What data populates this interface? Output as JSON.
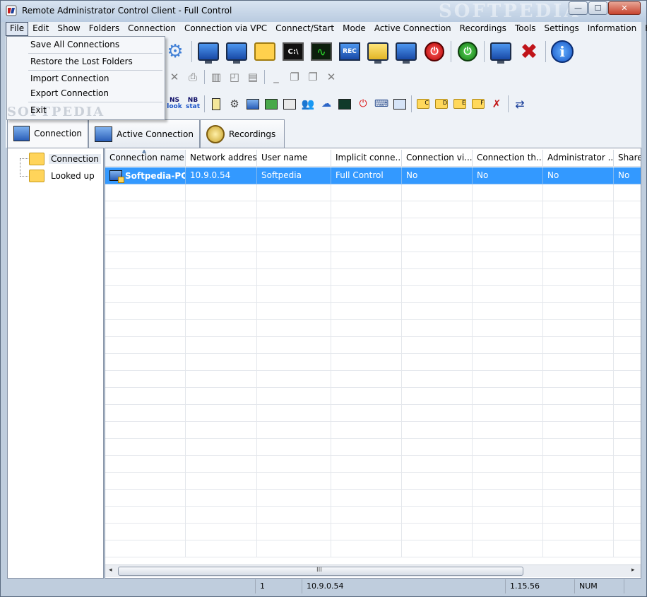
{
  "window": {
    "title": "Remote Administrator Control Client - Full Control",
    "watermark": "SOFTPEDIA",
    "controls": {
      "minimize": "—",
      "maximize": "☐",
      "close": "✕"
    }
  },
  "menubar": {
    "items": [
      "File",
      "Edit",
      "Show",
      "Folders",
      "Connection",
      "Connection via VPC",
      "Connect/Start",
      "Mode",
      "Active Connection",
      "Recordings",
      "Tools",
      "Settings",
      "Information",
      "Help"
    ],
    "active": "File"
  },
  "file_menu": {
    "items": [
      "Save All Connections",
      "Restore the Lost Folders",
      "Import Connection",
      "Export Connection",
      "Exit"
    ],
    "watermark": "SOFTPEDIA"
  },
  "toolbar": {
    "cmd_label": "C:\\",
    "rec_label": "REC",
    "ns_label_top": "NS",
    "ns_label_bottom": "look",
    "nb_label_top": "NB",
    "nb_label_bottom": "stat",
    "drive_c": "C",
    "drive_d": "D",
    "drive_e": "E",
    "drive_f": "F"
  },
  "tabs": [
    "Connection",
    "Active Connection",
    "Recordings"
  ],
  "tree": {
    "items": [
      "Connection",
      "Looked up"
    ],
    "selected": "Connection"
  },
  "list": {
    "columns": [
      "Connection name",
      "Network address",
      "User name",
      "Implicit conne...",
      "Connection vi...",
      "Connection th...",
      "Administrator ...",
      "Share"
    ],
    "rows": [
      [
        "Softpedia-PC",
        "10.9.0.54",
        "Softpedia",
        "Full Control",
        "No",
        "No",
        "No",
        "No"
      ]
    ],
    "scroll_left": "◂",
    "scroll_right": "▸",
    "scroll_grip": "III"
  },
  "status": {
    "count": "1",
    "address": "10.9.0.54",
    "version": "1.15.56",
    "num": "NUM"
  },
  "colors": {
    "selection": "#3399ff",
    "accent": "#1849a6"
  }
}
